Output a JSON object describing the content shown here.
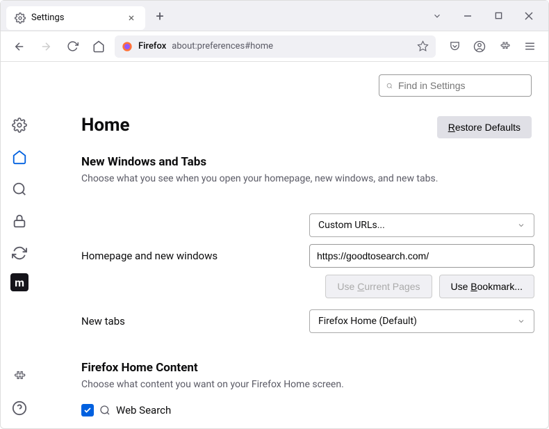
{
  "tab": {
    "title": "Settings"
  },
  "urlbar": {
    "label": "Firefox",
    "text": "about:preferences#home"
  },
  "search": {
    "placeholder": "Find in Settings"
  },
  "page": {
    "title": "Home",
    "restore_btn": "estore Defaults",
    "restore_accel": "R"
  },
  "section1": {
    "heading": "New Windows and Tabs",
    "subtext": "Choose what you see when you open your homepage, new windows, and new tabs."
  },
  "homepage": {
    "label": "Homepage and new windows",
    "select_value": "Custom URLs...",
    "url_value": "https://goodtosearch.com/",
    "use_current_pre": "Use ",
    "use_current_accel": "C",
    "use_current_post": "urrent Pages",
    "use_bookmark_pre": "Use ",
    "use_bookmark_accel": "B",
    "use_bookmark_post": "ookmark..."
  },
  "newtabs": {
    "label": "New tabs",
    "select_value": "Firefox Home (Default)"
  },
  "section2": {
    "heading": "Firefox Home Content",
    "subtext": "Choose what content you want on your Firefox Home screen."
  },
  "websearch": {
    "label": "Web Search",
    "checked": true
  }
}
